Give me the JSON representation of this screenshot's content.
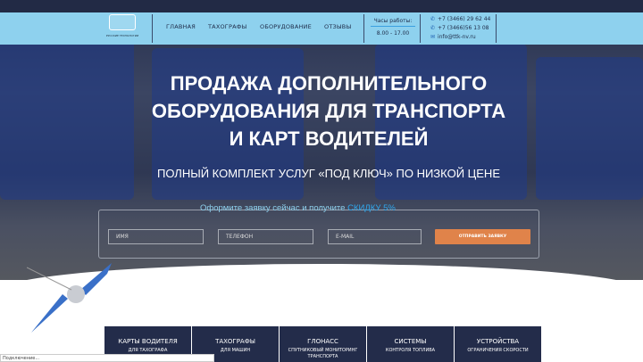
{
  "header": {
    "logo_text": "РУССКИЕ ТЕХНОЛОГИИ",
    "nav": [
      "ГЛАВНАЯ",
      "ТАХОГРАФЫ",
      "ОБОРУДОВАНИЕ",
      "ОТЗЫВЫ"
    ],
    "hours_label": "Часы работы:",
    "hours": "8.00 - 17.00",
    "phones": [
      "+7 (3466) 29 62 44",
      "+7 (3466)56 13 08"
    ],
    "email": "info@ttk-nv.ru"
  },
  "hero": {
    "title_lines": [
      "ПРОДАЖА ДОПОЛНИТЕЛЬНОГО",
      "ОБОРУДОВАНИЯ ДЛЯ ТРАНСПОРТА",
      "И КАРТ ВОДИТЕЛЕЙ"
    ],
    "subtitle": "ПОЛНЫЙ КОМПЛЕКТ УСЛУГ «ПОД КЛЮЧ» ПО НИЗКОЙ ЦЕНЕ"
  },
  "form": {
    "title": "Оформите заявку сейчас и получите ",
    "discount": "СКИДКУ 5%",
    "name_placeholder": "ИМЯ",
    "phone_placeholder": "ТЕЛЕФОН",
    "email_placeholder": "E-MAIL",
    "submit": "ОТПРАВИТЬ ЗАЯВКУ"
  },
  "cards": [
    {
      "title": "КАРТЫ ВОДИТЕЛЯ",
      "sub": "ДЛЯ ТАХОГРАФА"
    },
    {
      "title": "ТАХОГРАФЫ",
      "sub": "ДЛЯ МАШИН"
    },
    {
      "title": "ГЛОНАСС",
      "sub": "СПУТНИКОВЫЙ МОНИТОРИНГ ТРАНСПОРТА"
    },
    {
      "title": "СИСТЕМЫ",
      "sub": "КОНТРОЛЯ ТОПЛИВА"
    },
    {
      "title": "УСТРОЙСТВА",
      "sub": "ОГРАНИЧЕНИЯ СКОРОСТИ"
    }
  ],
  "status_bar": "Подключение...",
  "colors": {
    "header": "#8ed1ee",
    "dark": "#232c4a",
    "accent": "#e0834a"
  }
}
